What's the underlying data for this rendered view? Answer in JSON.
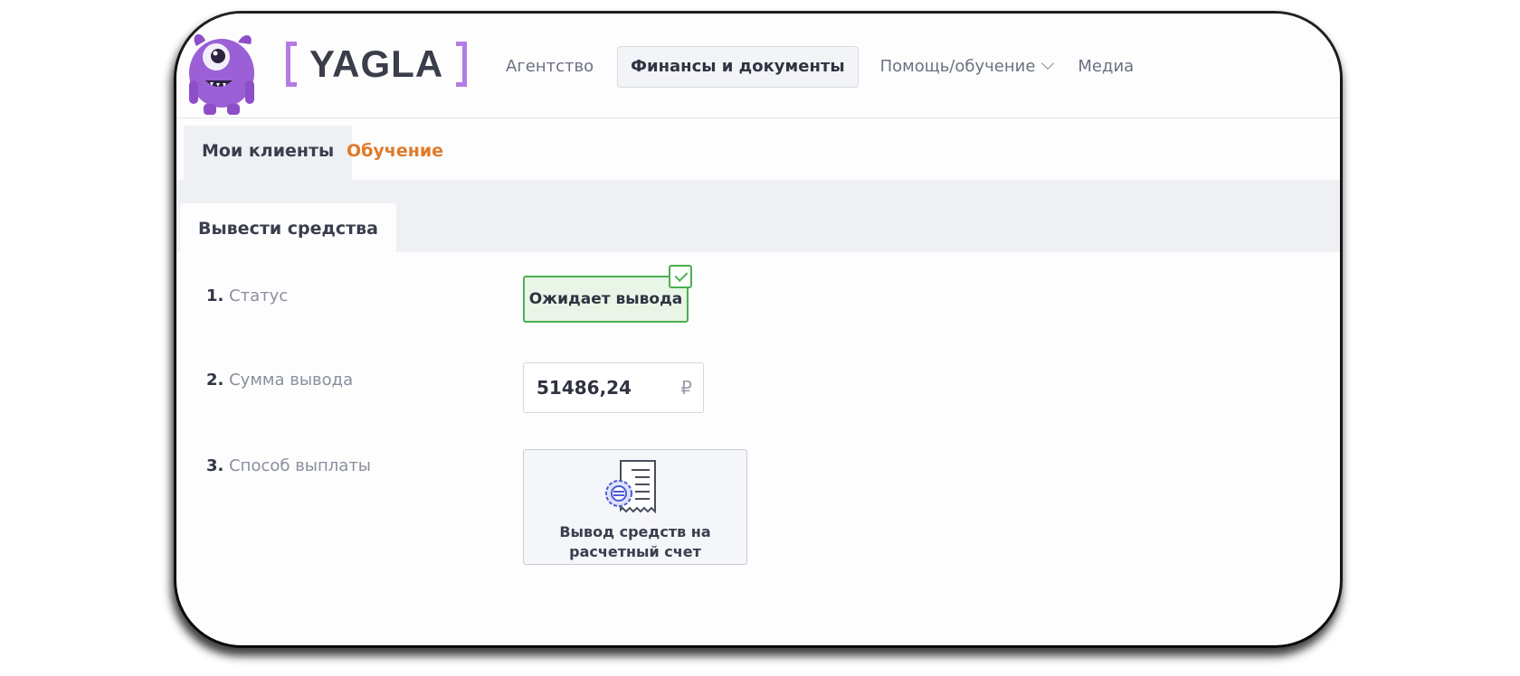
{
  "brand": {
    "name": "YAGLA",
    "bracket_color": "#b57be6"
  },
  "nav": {
    "items": [
      {
        "label": "Агентство"
      },
      {
        "label": "Финансы и документы",
        "active": true
      },
      {
        "label": "Помощь/обучение",
        "icon": "chevron-down-icon"
      },
      {
        "label": "Медиа"
      }
    ]
  },
  "tabs": [
    {
      "label": "Мои клиенты",
      "active": true
    },
    {
      "label": "Обучение",
      "color": "#e07a2a"
    }
  ],
  "subtab": {
    "label": "Вывести средства"
  },
  "form": {
    "status": {
      "num": "1.",
      "label": "Статус",
      "value": "Ожидает вывода",
      "icon": "check-icon",
      "color": "#4caf50"
    },
    "amount": {
      "num": "2.",
      "label": "Сумма вывода",
      "value": "51486,24",
      "currency": "₽"
    },
    "method": {
      "num": "3.",
      "label": "Способ выплаты",
      "option_line1": "Вывод средств на",
      "option_line2": "расчетный счет",
      "icon": "document-seal-icon"
    }
  }
}
